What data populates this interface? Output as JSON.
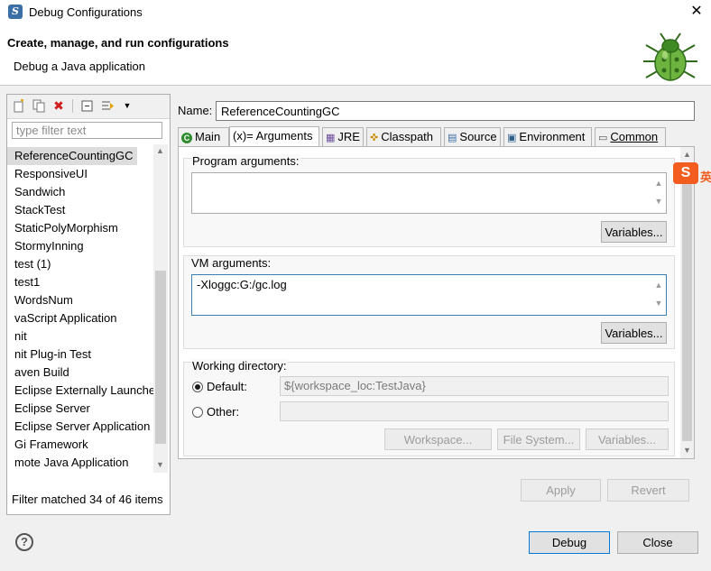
{
  "window": {
    "title": "Debug Configurations",
    "close": "✕"
  },
  "banner": {
    "title": "Create, manage, and run configurations",
    "subtitle": "Debug a Java application"
  },
  "left": {
    "filter_placeholder": "type filter text",
    "items": [
      "ReferenceCountingGC",
      "ResponsiveUI",
      "Sandwich",
      "StackTest",
      "StaticPolyMorphism",
      "StormyInning",
      "test (1)",
      "test1",
      "WordsNum",
      "vaScript Application",
      "nit",
      "nit Plug-in Test",
      "aven Build",
      "Eclipse Externally Launche",
      "Eclipse Server",
      "Eclipse Server Application",
      "Gi Framework",
      "mote Java Application"
    ],
    "selected": "ReferenceCountingGC",
    "status": "Filter matched 34 of 46 items"
  },
  "name": {
    "label": "Name:",
    "value": "ReferenceCountingGC"
  },
  "tabs": [
    "Main",
    "(x)= Arguments",
    "JRE",
    "Classpath",
    "Source",
    "Environment",
    "Common"
  ],
  "active_tab": "(x)= Arguments",
  "program_args": {
    "label": "Program arguments:",
    "value": "",
    "variables": "Variables..."
  },
  "vm_args": {
    "label": "VM arguments:",
    "value": "-Xloggc:G:/gc.log",
    "variables": "Variables..."
  },
  "working_dir": {
    "label": "Working directory:",
    "default_label": "Default:",
    "default_value": "${workspace_loc:TestJava}",
    "other_label": "Other:",
    "other_value": "",
    "workspace": "Workspace...",
    "filesystem": "File System...",
    "variables": "Variables..."
  },
  "buttons": {
    "apply": "Apply",
    "revert": "Revert",
    "debug": "Debug",
    "close": "Close",
    "help": "?"
  },
  "ime": {
    "badge": "S",
    "tail": "英"
  },
  "colors": {
    "selected_bg": "#dcdcdc",
    "focus_border": "#3c7fb1",
    "default_button_border": "#0078d7",
    "error_icon": "#d11f1f"
  }
}
